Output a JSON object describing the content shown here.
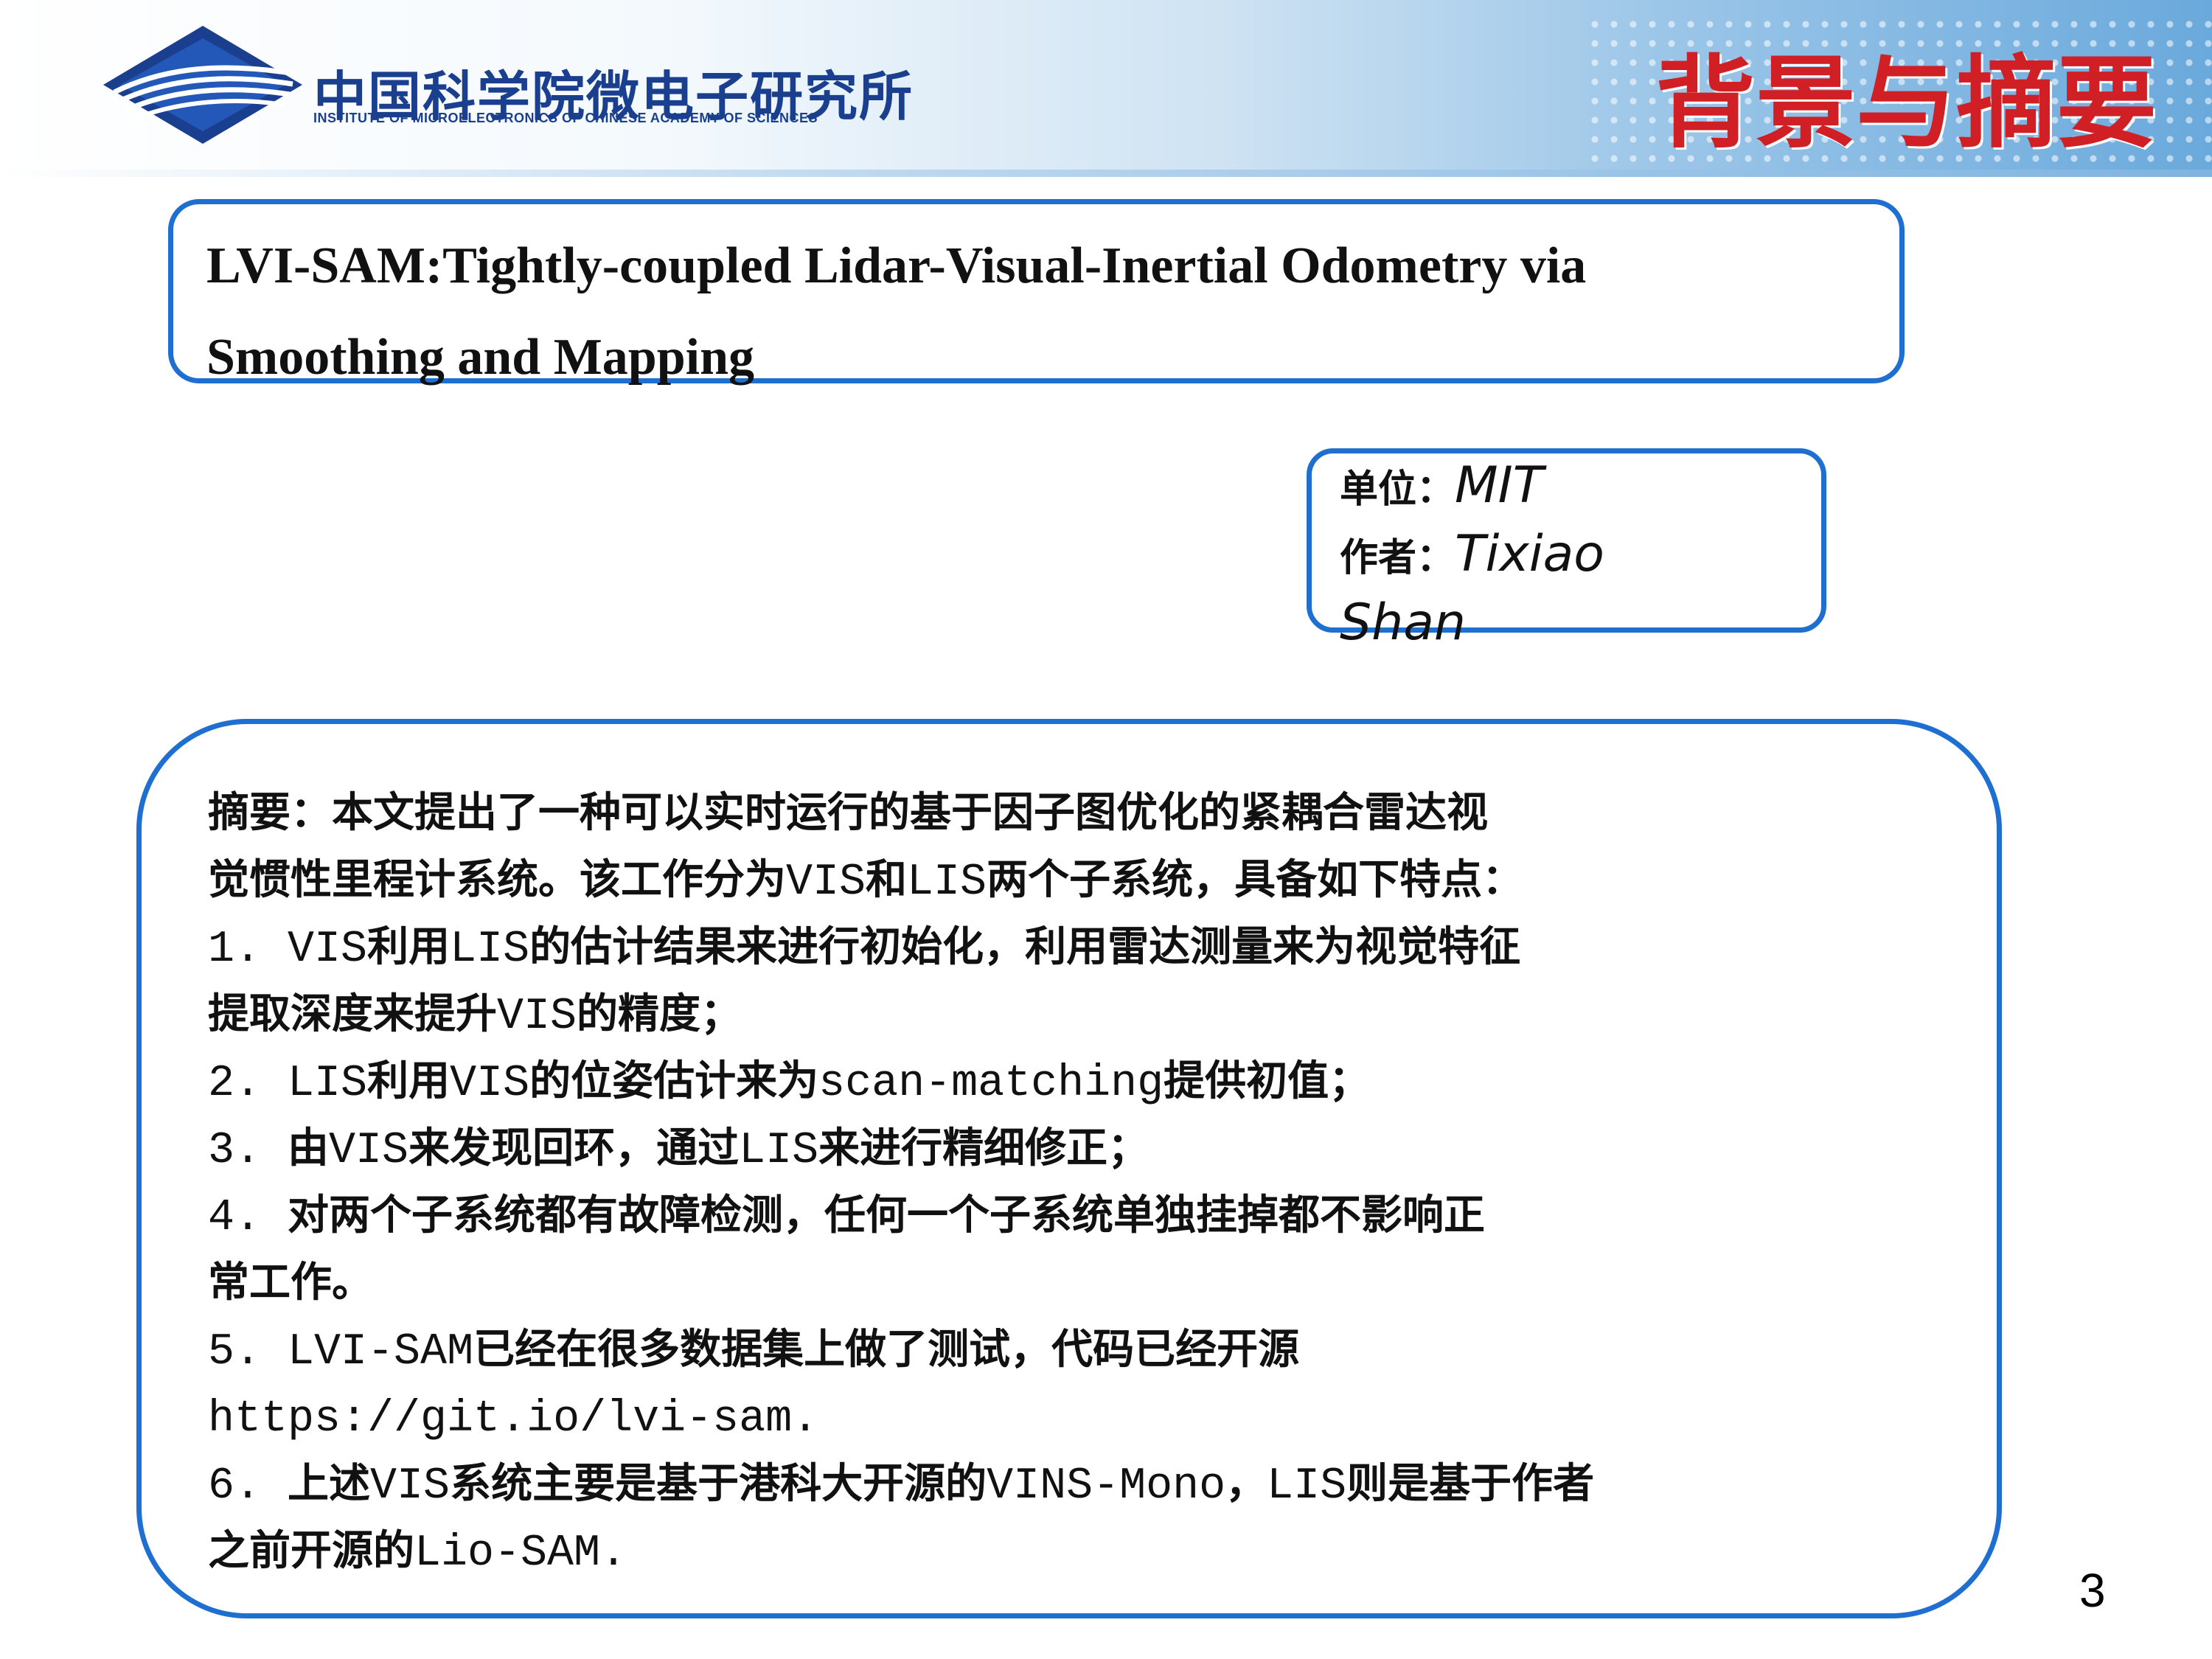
{
  "header": {
    "institute_cn": "中国科学院微电子研究所",
    "institute_en": "INSTITUTE OF MICROELECTRONICS OF CHINESE ACADEMY OF SCIENCES",
    "section_title": "背景与摘要",
    "logo_icon": "ime-cas-logo-icon"
  },
  "paper": {
    "title_line1": "LVI-SAM:Tightly-coupled Lidar-Visual-Inertial Odometry via",
    "title_line2": "Smoothing and Mapping"
  },
  "meta": {
    "unit_label": "单位：",
    "unit_value": "MIT",
    "author_label": "作者：",
    "author_value": "Tixiao",
    "author_value_2": "Shan"
  },
  "abstract": {
    "lines": [
      [
        {
          "t": "摘要：本文提出了一种可以实时运行的基于因子图优化的紧耦合雷达视",
          "s": "cn"
        }
      ],
      [
        {
          "t": "觉惯性里程计系统。该工作分为",
          "s": "cn"
        },
        {
          "t": "VIS",
          "s": "en"
        },
        {
          "t": "和",
          "s": "cn"
        },
        {
          "t": "LIS",
          "s": "en"
        },
        {
          "t": "两个子系统，具备如下特点：",
          "s": "cn"
        }
      ],
      [
        {
          "t": "1. ",
          "s": "en"
        },
        {
          "t": "VIS",
          "s": "en"
        },
        {
          "t": "利用",
          "s": "cn"
        },
        {
          "t": "LIS",
          "s": "en"
        },
        {
          "t": "的估计结果来进行初始化，利用雷达测量来为视觉特征",
          "s": "cn"
        }
      ],
      [
        {
          "t": "提取深度来提升",
          "s": "cn"
        },
        {
          "t": "VIS",
          "s": "en"
        },
        {
          "t": "的精度；",
          "s": "cn"
        }
      ],
      [
        {
          "t": "2. ",
          "s": "en"
        },
        {
          "t": "LIS",
          "s": "en"
        },
        {
          "t": "利用",
          "s": "cn"
        },
        {
          "t": "VIS",
          "s": "en"
        },
        {
          "t": "的位姿估计来为",
          "s": "cn"
        },
        {
          "t": "scan-matching",
          "s": "en"
        },
        {
          "t": "提供初值；",
          "s": "cn"
        }
      ],
      [
        {
          "t": "3. ",
          "s": "en"
        },
        {
          "t": "由",
          "s": "cn"
        },
        {
          "t": "VIS",
          "s": "en"
        },
        {
          "t": "来发现回环，通过",
          "s": "cn"
        },
        {
          "t": "LIS",
          "s": "en"
        },
        {
          "t": "来进行精细修正；",
          "s": "cn"
        }
      ],
      [
        {
          "t": "4. ",
          "s": "en"
        },
        {
          "t": "对两个子系统都有故障检测，任何一个子系统单独挂掉都不影响正",
          "s": "cn"
        }
      ],
      [
        {
          "t": "常工作。",
          "s": "cn"
        }
      ],
      [
        {
          "t": "5. ",
          "s": "en"
        },
        {
          "t": "LVI-SAM",
          "s": "en"
        },
        {
          "t": "已经在很多数据集上做了测试，代码已经开源",
          "s": "cn"
        }
      ],
      [
        {
          "t": "https://git.io/lvi-sam.",
          "s": "en"
        }
      ],
      [
        {
          "t": "6. ",
          "s": "en"
        },
        {
          "t": "上述",
          "s": "cn"
        },
        {
          "t": "VIS",
          "s": "en"
        },
        {
          "t": "系统主要是基于港科大开源的",
          "s": "cn"
        },
        {
          "t": "VINS-Mono",
          "s": "en"
        },
        {
          "t": "，",
          "s": "cn"
        },
        {
          "t": "LIS",
          "s": "en"
        },
        {
          "t": "则是基于作者",
          "s": "cn"
        }
      ],
      [
        {
          "t": "之前开源的",
          "s": "cn"
        },
        {
          "t": "Lio-SAM.",
          "s": "en"
        }
      ]
    ]
  },
  "footer": {
    "page_number": "3"
  },
  "colors": {
    "accent_blue": "#1e6fd0",
    "title_red": "#d11f26",
    "institute_blue": "#1a3f8f"
  }
}
